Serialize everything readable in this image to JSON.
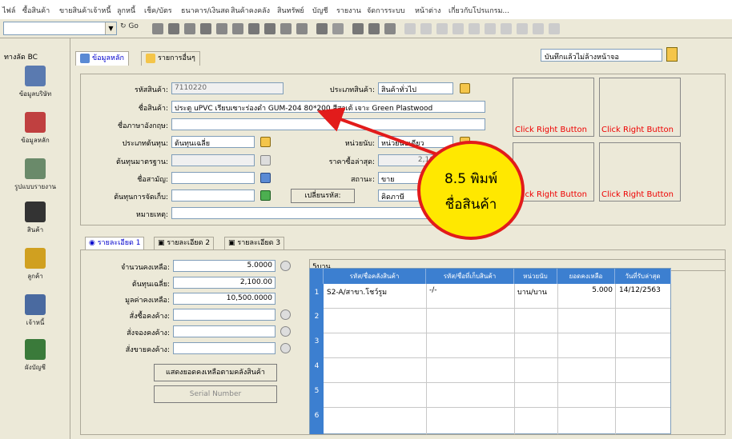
{
  "menu": [
    "ไฟล์",
    "ซื้อสินค้า",
    "ขายสินค้า",
    "เจ้าหนี้",
    "ลูกหนี้",
    "เช็ค/บัตร",
    "ธนาคาร/เงินสด",
    "สินค้าคงคลัง",
    "สินทรัพย์",
    "บัญชี",
    "รายงาน",
    "จัดการระบบ",
    "หน้าต่าง",
    "เกี่ยวกับโปรแกรม..."
  ],
  "toolbar": {
    "go_label": "Go"
  },
  "sidebar": {
    "title": "ทางลัด BC",
    "items": [
      "ข้อมูลบริษัท",
      "ข้อมูลหลัก",
      "รูปแบบรายงาน",
      "สินค้า",
      "ลูกค้า",
      "เจ้าหนี้",
      "ผังบัญชี"
    ]
  },
  "tabs": {
    "main": "ข้อมูลหลัก",
    "other": "รายการอื่นๆ"
  },
  "header": {
    "status": "บันทึกแล้วไม่ล้างหน้าจอ"
  },
  "form": {
    "code_label": "รหัสสินค้า:",
    "code_value": "7110220",
    "type_label": "ประเภทสินค้า:",
    "type_value": "สินค้าทั่วไป",
    "name_label": "ชื่อสินค้า:",
    "name_value": "ประตู uPVC เรียบเซาะร่องดำ GUM-204 80*200 สีสาเต้ เจาะ Green Plastwood",
    "name_en_label": "ชื่อภาษาอังกฤษ:",
    "name_en_value": "",
    "costtype_label": "ประเภทต้นทุน:",
    "costtype_value": "ต้นทุนเฉลี่ย",
    "unit_label": "หน่วยนับ:",
    "unit_value": "หน่วยนับเดียว",
    "stdcost_label": "ต้นทุนมาตรฐาน:",
    "stdcost_value": "",
    "lastbuy_label": "ราคาซื้อล่าสุด:",
    "lastbuy_value": "2,100.00",
    "common_label": "ชื่อสามัญ:",
    "common_value": "",
    "status_label": "สถานะ:",
    "status_value": "ขาย",
    "costcalc_label": "ต้นทุนการจัดเก็บ:",
    "costcalc_value": "",
    "change_btn": "เปลี่ยนรหัส:",
    "change_value": "คิดภาษี",
    "note_label": "หมายเหตุ:",
    "note_value": ""
  },
  "right_buttons": [
    "Click Right Button",
    "Click Right Button",
    "Click Right Button",
    "Click Right Button"
  ],
  "detail_tabs": [
    "รายละเอียด 1",
    "รายละเอียด 2",
    "รายละเอียด 3"
  ],
  "detail": {
    "qty_label": "จำนวนคงเหลือ:",
    "qty_value": "5.0000",
    "avgcost_label": "ต้นทุนเฉลี่ย:",
    "avgcost_value": "2,100.00",
    "stockval_label": "มูลค่าคงเหลือ:",
    "stockval_value": "10,500.0000",
    "po_label": "สั่งซื้อคงค้าง:",
    "reserve_label": "สั่งจองคงค้าง:",
    "so_label": "สั่งขายคงค้าง:",
    "show_btn": "แสดงยอดคงเหลือตามคลังสินค้า",
    "serial_btn": "Serial Number",
    "unit_text": "5บาน"
  },
  "grid": {
    "headers": [
      "รหัส/ชื่อคลังสินค้า",
      "รหัส/ชื่อที่เก็บสินค้า",
      "หน่วยนับ",
      "ยอดคงเหลือ",
      "วันที่รับล่าสุด"
    ],
    "row_numbers": [
      "1",
      "2",
      "3",
      "4",
      "5",
      "6"
    ],
    "rows": [
      [
        "S2-A/สาขา.โชว์รูม",
        "-/-",
        "บาน/บาน",
        "5.000",
        "14/12/2563"
      ]
    ]
  },
  "callout": {
    "line1": "8.5 พิมพ์",
    "line2": "ชื่อสินค้า",
    "color": "#e21b1b",
    "fill": "#ffe800"
  }
}
